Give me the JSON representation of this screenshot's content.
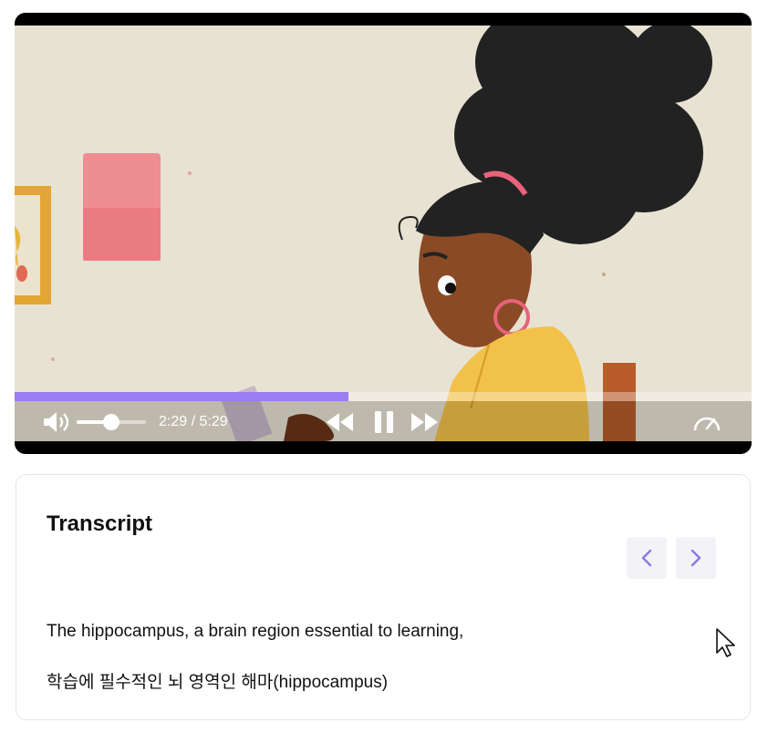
{
  "player": {
    "time_display": "2:29 / 5:29",
    "current_time": "2:29",
    "duration": "5:29",
    "progress": 0.453,
    "volume": 0.5,
    "accent_color": "#9b7cf2",
    "icons": {
      "volume": "volume-icon",
      "rewind": "rewind-icon",
      "pause": "pause-icon",
      "forward": "fast-forward-icon",
      "speed": "speedometer-icon"
    }
  },
  "transcript": {
    "title": "Transcript",
    "lines": [
      "The hippocampus, a brain region essential to learning,",
      "학습에 필수적인 뇌 영역인 해마(hippocampus)"
    ],
    "icons": {
      "prev": "chevron-left-icon",
      "next": "chevron-right-icon"
    }
  }
}
